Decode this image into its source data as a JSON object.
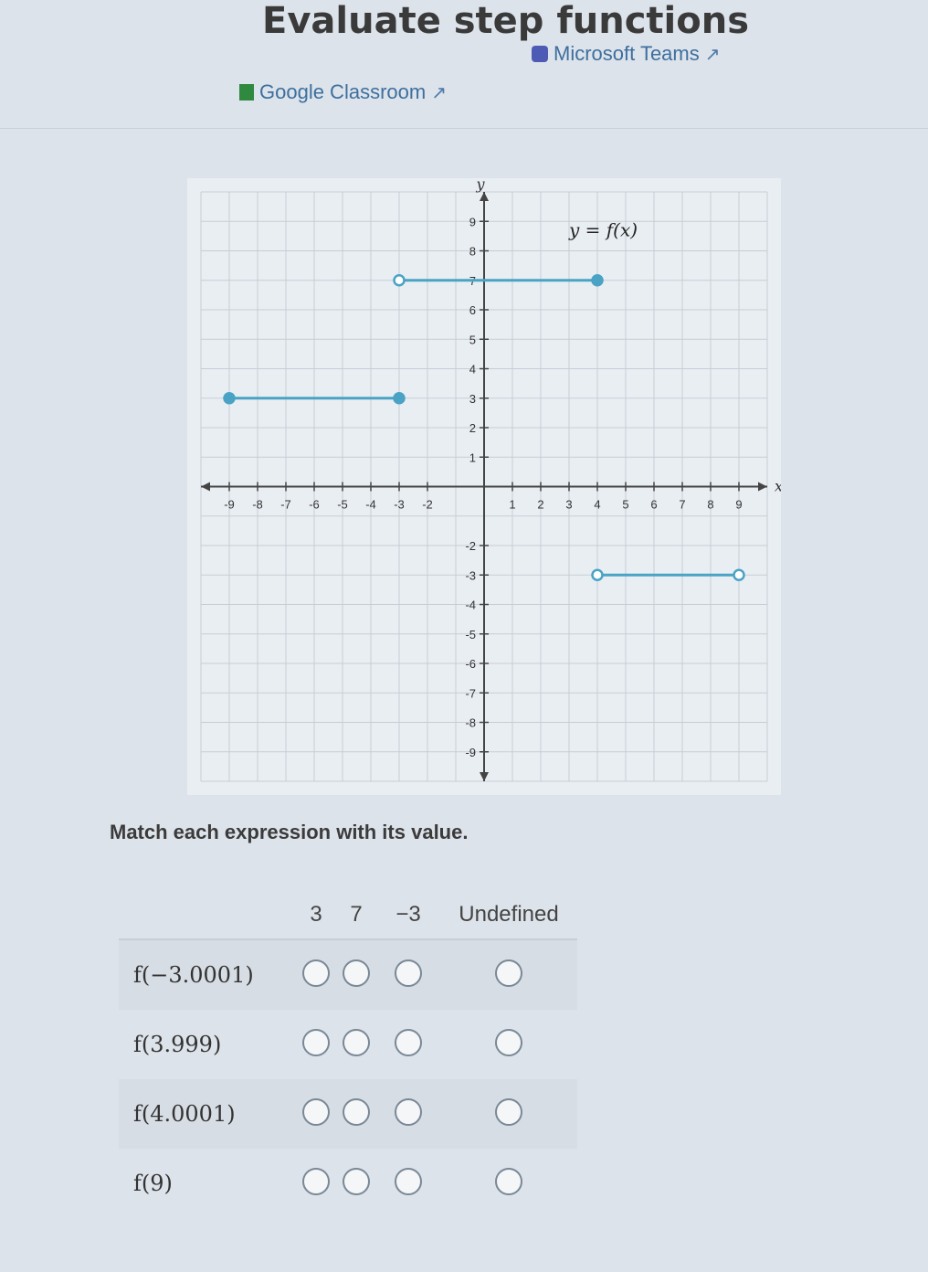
{
  "page": {
    "title": "Evaluate step functions",
    "share": {
      "google_classroom": "Google Classroom",
      "microsoft_teams": "Microsoft Teams"
    }
  },
  "chart_data": {
    "type": "line",
    "xlabel": "x",
    "ylabel": "y",
    "xlim": [
      -10,
      10
    ],
    "ylim": [
      -10,
      10
    ],
    "grid": true,
    "annotation": "y = f(x)",
    "x_ticks": [
      "-9",
      "-8",
      "-7",
      "-6",
      "-5",
      "-4",
      "-3",
      "-2",
      "1",
      "2",
      "3",
      "4",
      "5",
      "6",
      "7",
      "8",
      "9"
    ],
    "y_ticks": [
      "9",
      "8",
      "7",
      "6",
      "5",
      "4",
      "3",
      "2",
      "1",
      "-2",
      "-3",
      "-4",
      "-5",
      "-6",
      "-7",
      "-8",
      "-9"
    ],
    "series": [
      {
        "x": [
          -9,
          -3
        ],
        "y": [
          3,
          3
        ],
        "left_endpoint": "closed",
        "right_endpoint": "closed"
      },
      {
        "x": [
          -3,
          4
        ],
        "y": [
          7,
          7
        ],
        "left_endpoint": "open",
        "right_endpoint": "closed"
      },
      {
        "x": [
          4,
          9
        ],
        "y": [
          -3,
          -3
        ],
        "left_endpoint": "open",
        "right_endpoint": "open"
      }
    ]
  },
  "question": {
    "prompt": "Match each expression with its value.",
    "columns": [
      "3",
      "7",
      "−3",
      "Undefined"
    ],
    "rows": [
      {
        "expression": "f(−3.0001)"
      },
      {
        "expression": "f(3.999)"
      },
      {
        "expression": "f(4.0001)"
      },
      {
        "expression": "f(9)"
      }
    ]
  },
  "colors": {
    "accent": "#4aa3c4",
    "link": "#3d6f9f"
  }
}
